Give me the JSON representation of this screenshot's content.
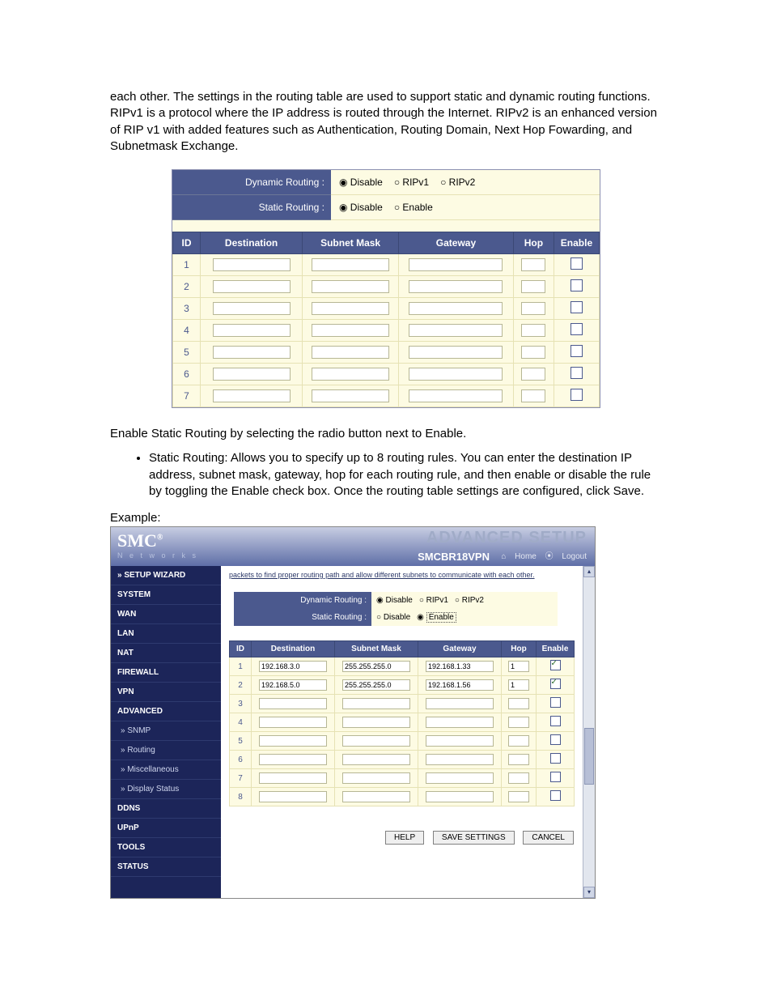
{
  "doc": {
    "p1": "each other. The settings in the routing table are used to support static and dynamic routing functions. RIPv1 is a protocol where the IP address is routed through the Internet. RIPv2 is an enhanced version of RIP v1 with added features such as Authentication, Routing Domain, Next Hop Fowarding, and Subnetmask Exchange.",
    "p2": "Enable Static Routing by selecting the radio button next to Enable.",
    "bullet1": "Static Routing: Allows you to specify up to 8 routing rules. You can enter the destination IP address, subnet mask, gateway, hop for each routing rule, and then enable or disable the rule by toggling the Enable check box. Once the routing table settings are configured, click Save.",
    "example_label": "Example:"
  },
  "panel1": {
    "dynamic_label": "Dynamic Routing :",
    "static_label": "Static Routing :",
    "opts_dynamic": [
      "Disable",
      "RIPv1",
      "RIPv2"
    ],
    "opts_static": [
      "Disable",
      "Enable"
    ],
    "dynamic_selected": "Disable",
    "static_selected": "Disable",
    "headers": {
      "id": "ID",
      "dest": "Destination",
      "mask": "Subnet Mask",
      "gw": "Gateway",
      "hop": "Hop",
      "en": "Enable"
    },
    "rows": [
      {
        "id": "1",
        "dest": "",
        "mask": "",
        "gw": "",
        "hop": "",
        "en": false
      },
      {
        "id": "2",
        "dest": "",
        "mask": "",
        "gw": "",
        "hop": "",
        "en": false
      },
      {
        "id": "3",
        "dest": "",
        "mask": "",
        "gw": "",
        "hop": "",
        "en": false
      },
      {
        "id": "4",
        "dest": "",
        "mask": "",
        "gw": "",
        "hop": "",
        "en": false
      },
      {
        "id": "5",
        "dest": "",
        "mask": "",
        "gw": "",
        "hop": "",
        "en": false
      },
      {
        "id": "6",
        "dest": "",
        "mask": "",
        "gw": "",
        "hop": "",
        "en": false
      },
      {
        "id": "7",
        "dest": "",
        "mask": "",
        "gw": "",
        "hop": "",
        "en": false
      }
    ]
  },
  "shot": {
    "logo": "SMC",
    "logo_reg": "®",
    "logo_sub": "N e t w o r k s",
    "title": "ADVANCED SETUP",
    "model": "SMCBR18VPN",
    "home": "Home",
    "logout": "Logout",
    "intro": "packets to find proper routing path and allow different subnets to communicate with each other.",
    "nav": [
      {
        "label": "» SETUP WIZARD",
        "sub": false
      },
      {
        "label": "SYSTEM",
        "sub": false
      },
      {
        "label": "WAN",
        "sub": false
      },
      {
        "label": "LAN",
        "sub": false
      },
      {
        "label": "NAT",
        "sub": false
      },
      {
        "label": "FIREWALL",
        "sub": false
      },
      {
        "label": "VPN",
        "sub": false
      },
      {
        "label": "ADVANCED",
        "sub": false
      },
      {
        "label": "» SNMP",
        "sub": true
      },
      {
        "label": "» Routing",
        "sub": true
      },
      {
        "label": "» Miscellaneous",
        "sub": true
      },
      {
        "label": "» Display Status",
        "sub": true
      },
      {
        "label": "DDNS",
        "sub": false
      },
      {
        "label": "UPnP",
        "sub": false
      },
      {
        "label": "TOOLS",
        "sub": false
      },
      {
        "label": "STATUS",
        "sub": false
      }
    ],
    "dynamic_label": "Dynamic Routing :",
    "static_label": "Static Routing :",
    "opts_dynamic": [
      "Disable",
      "RIPv1",
      "RIPv2"
    ],
    "opts_static": [
      "Disable",
      "Enable"
    ],
    "dynamic_selected": "Disable",
    "static_selected": "Enable",
    "headers": {
      "id": "ID",
      "dest": "Destination",
      "mask": "Subnet Mask",
      "gw": "Gateway",
      "hop": "Hop",
      "en": "Enable"
    },
    "rows": [
      {
        "id": "1",
        "dest": "192.168.3.0",
        "mask": "255.255.255.0",
        "gw": "192.168.1.33",
        "hop": "1",
        "en": true
      },
      {
        "id": "2",
        "dest": "192.168.5.0",
        "mask": "255.255.255.0",
        "gw": "192.168.1.56",
        "hop": "1",
        "en": true
      },
      {
        "id": "3",
        "dest": "",
        "mask": "",
        "gw": "",
        "hop": "",
        "en": false
      },
      {
        "id": "4",
        "dest": "",
        "mask": "",
        "gw": "",
        "hop": "",
        "en": false
      },
      {
        "id": "5",
        "dest": "",
        "mask": "",
        "gw": "",
        "hop": "",
        "en": false
      },
      {
        "id": "6",
        "dest": "",
        "mask": "",
        "gw": "",
        "hop": "",
        "en": false
      },
      {
        "id": "7",
        "dest": "",
        "mask": "",
        "gw": "",
        "hop": "",
        "en": false
      },
      {
        "id": "8",
        "dest": "",
        "mask": "",
        "gw": "",
        "hop": "",
        "en": false
      }
    ],
    "buttons": {
      "help": "HELP",
      "save": "SAVE SETTINGS",
      "cancel": "CANCEL"
    }
  }
}
